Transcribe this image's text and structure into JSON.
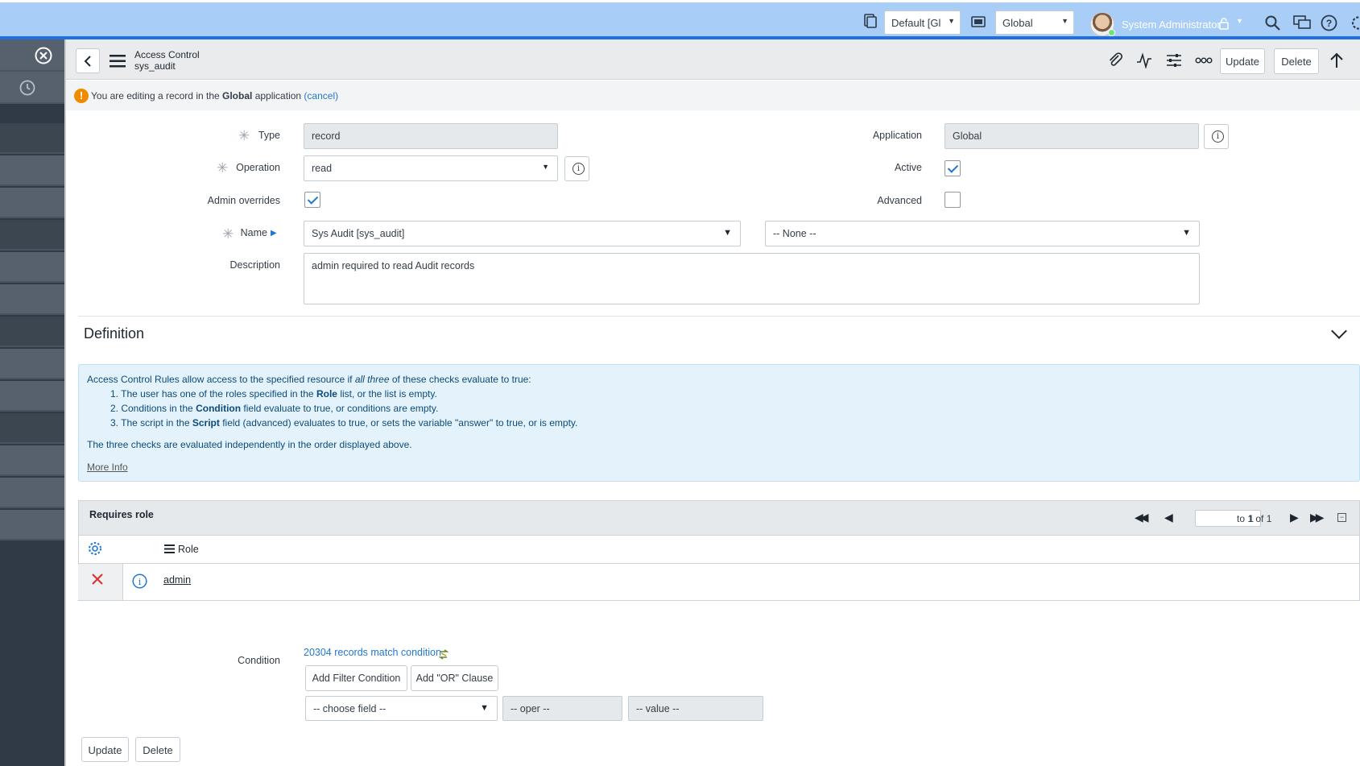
{
  "banner": {
    "update_set_value": "Default [Gl",
    "scope_value": "Global",
    "user_name": "System Administrator"
  },
  "form_header": {
    "title": "Access Control",
    "subtitle": "sys_audit",
    "update_label": "Update",
    "delete_label": "Delete"
  },
  "notice": {
    "prefix": "You are editing a record in the",
    "app": "Global",
    "suffix": "application",
    "cancel": "(cancel)"
  },
  "fields": {
    "type_label": "Type",
    "type_value": "record",
    "operation_label": "Operation",
    "operation_value": "read",
    "admin_overrides_label": "Admin overrides",
    "admin_overrides_checked": true,
    "name_label": "Name",
    "name_value": "Sys Audit [sys_audit]",
    "name_field_value": "-- None --",
    "description_label": "Description",
    "description_value": "admin required to read Audit records",
    "application_label": "Application",
    "application_value": "Global",
    "active_label": "Active",
    "active_checked": true,
    "advanced_label": "Advanced",
    "advanced_checked": false
  },
  "definition": {
    "title": "Definition",
    "intro_a": "Access Control Rules allow access to the specified resource if",
    "intro_em": "all three",
    "intro_b": "of these checks evaluate to true:",
    "item1_a": "1. The user has one of the roles specified in the",
    "item1_b": "Role",
    "item1_c": "list, or the list is empty.",
    "item2_a": "2. Conditions in the",
    "item2_b": "Condition",
    "item2_c": "field evaluate to true, or conditions are empty.",
    "item3_a": "3. The script in the",
    "item3_b": "Script",
    "item3_c": "field (advanced) evaluates to true, or sets the variable \"answer\" to true, or is empty.",
    "footer": "The three checks are evaluated independently in the order displayed above.",
    "more_info": "More Info"
  },
  "related_list": {
    "title": "Requires role",
    "page_value": "1",
    "page_total": "to 1 of 1",
    "column_role": "Role",
    "rows": [
      {
        "role": "admin"
      }
    ]
  },
  "condition": {
    "label": "Condition",
    "match_text": "20304 records match condition",
    "add_filter": "Add Filter Condition",
    "add_or": "Add \"OR\" Clause",
    "choose_field": "-- choose field --",
    "oper": "-- oper --",
    "value": "-- value --"
  },
  "footer_buttons": {
    "update": "Update",
    "delete": "Delete"
  }
}
